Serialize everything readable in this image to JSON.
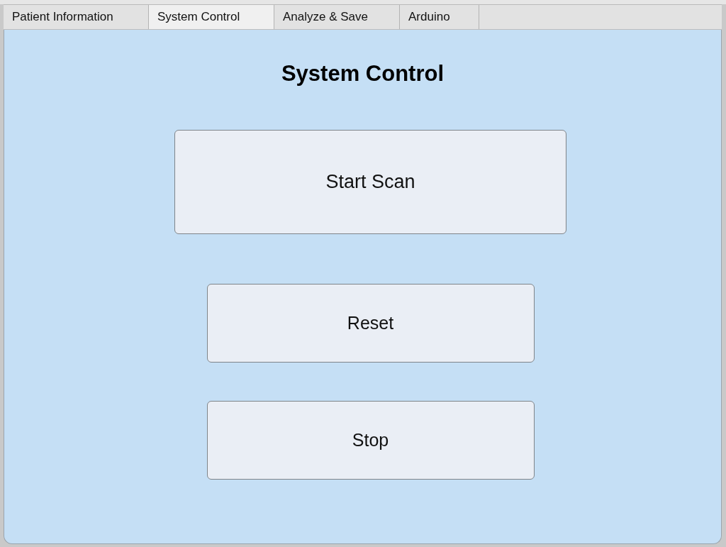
{
  "tabs": [
    {
      "label": "Patient Information",
      "selected": false
    },
    {
      "label": "System Control",
      "selected": true
    },
    {
      "label": "Analyze & Save",
      "selected": false
    },
    {
      "label": "Arduino",
      "selected": false
    }
  ],
  "panel": {
    "title": "System Control",
    "buttons": [
      {
        "label": "Start Scan",
        "kind": "large"
      },
      {
        "label": "Reset",
        "kind": "regular"
      },
      {
        "label": "Stop",
        "kind": "regular"
      }
    ]
  }
}
